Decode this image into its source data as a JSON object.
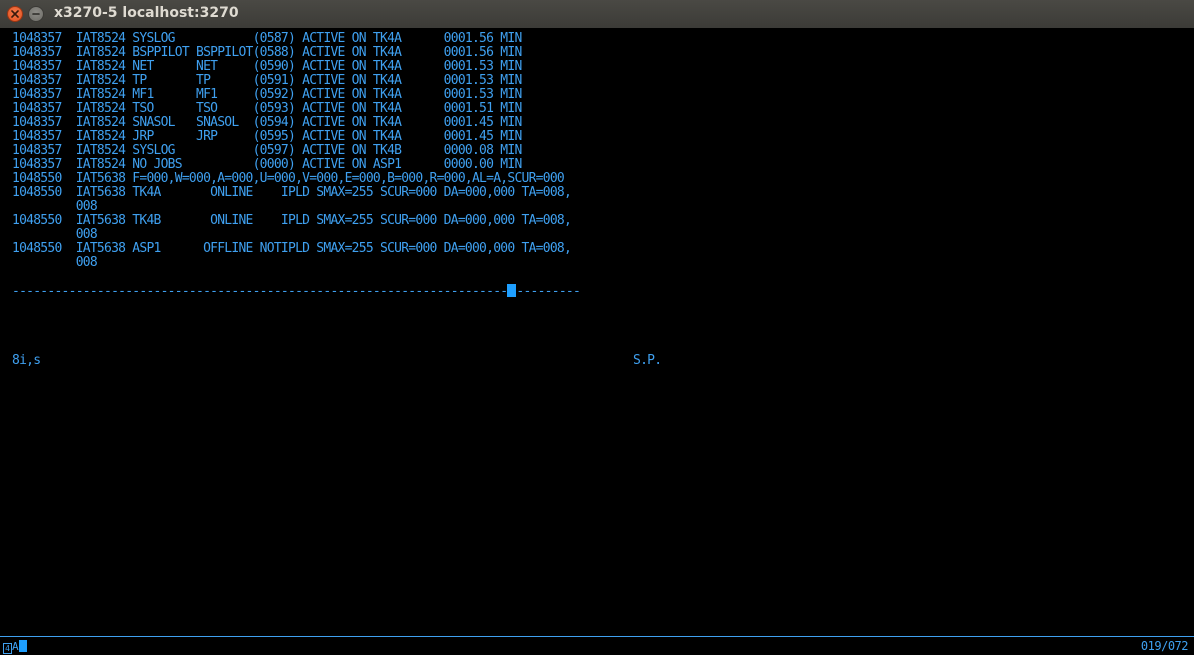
{
  "window": {
    "title": "x3270-5 localhost:3270"
  },
  "terminal": {
    "lines": [
      "1048357  IAT8524 SYSLOG           (0587) ACTIVE ON TK4A      0001.56 MIN",
      "1048357  IAT8524 BSPPILOT BSPPILOT(0588) ACTIVE ON TK4A      0001.56 MIN",
      "1048357  IAT8524 NET      NET     (0590) ACTIVE ON TK4A      0001.53 MIN",
      "1048357  IAT8524 TP       TP      (0591) ACTIVE ON TK4A      0001.53 MIN",
      "1048357  IAT8524 MF1      MF1     (0592) ACTIVE ON TK4A      0001.53 MIN",
      "1048357  IAT8524 TSO      TSO     (0593) ACTIVE ON TK4A      0001.51 MIN",
      "1048357  IAT8524 SNASOL   SNASOL  (0594) ACTIVE ON TK4A      0001.45 MIN",
      "1048357  IAT8524 JRP      JRP     (0595) ACTIVE ON TK4A      0001.45 MIN",
      "1048357  IAT8524 SYSLOG           (0597) ACTIVE ON TK4B      0000.08 MIN",
      "1048357  IAT8524 NO JOBS          (0000) ACTIVE ON ASP1      0000.00 MIN",
      "1048550  IAT5638 F=000,W=000,A=000,U=000,V=000,E=000,B=000,R=000,AL=A,SCUR=000",
      "1048550  IAT5638 TK4A       ONLINE    IPLD SMAX=255 SCUR=000 DA=000,000 TA=008,",
      "         008",
      "1048550  IAT5638 TK4B       ONLINE    IPLD SMAX=255 SCUR=000 DA=000,000 TA=008,",
      "         008",
      "1048550  IAT5638 ASP1      OFFLINE NOTIPLD SMAX=255 SCUR=000 DA=000,000 TA=008,",
      "         008"
    ],
    "separator_left": "----------------------------------------------------------------------",
    "separator_right": "---------",
    "command_input": "8i,s",
    "sp_label": "S.P."
  },
  "oia": {
    "indicator": "4",
    "lock_symbol": "A",
    "cursor_position": "019/072"
  },
  "colors": {
    "terminal_text": "#3fa0f0",
    "cursor": "#1e9fff",
    "background": "#000000",
    "close_button": "#e2511f"
  },
  "icons": {
    "close": "close-icon",
    "minimize": "minimize-icon"
  }
}
